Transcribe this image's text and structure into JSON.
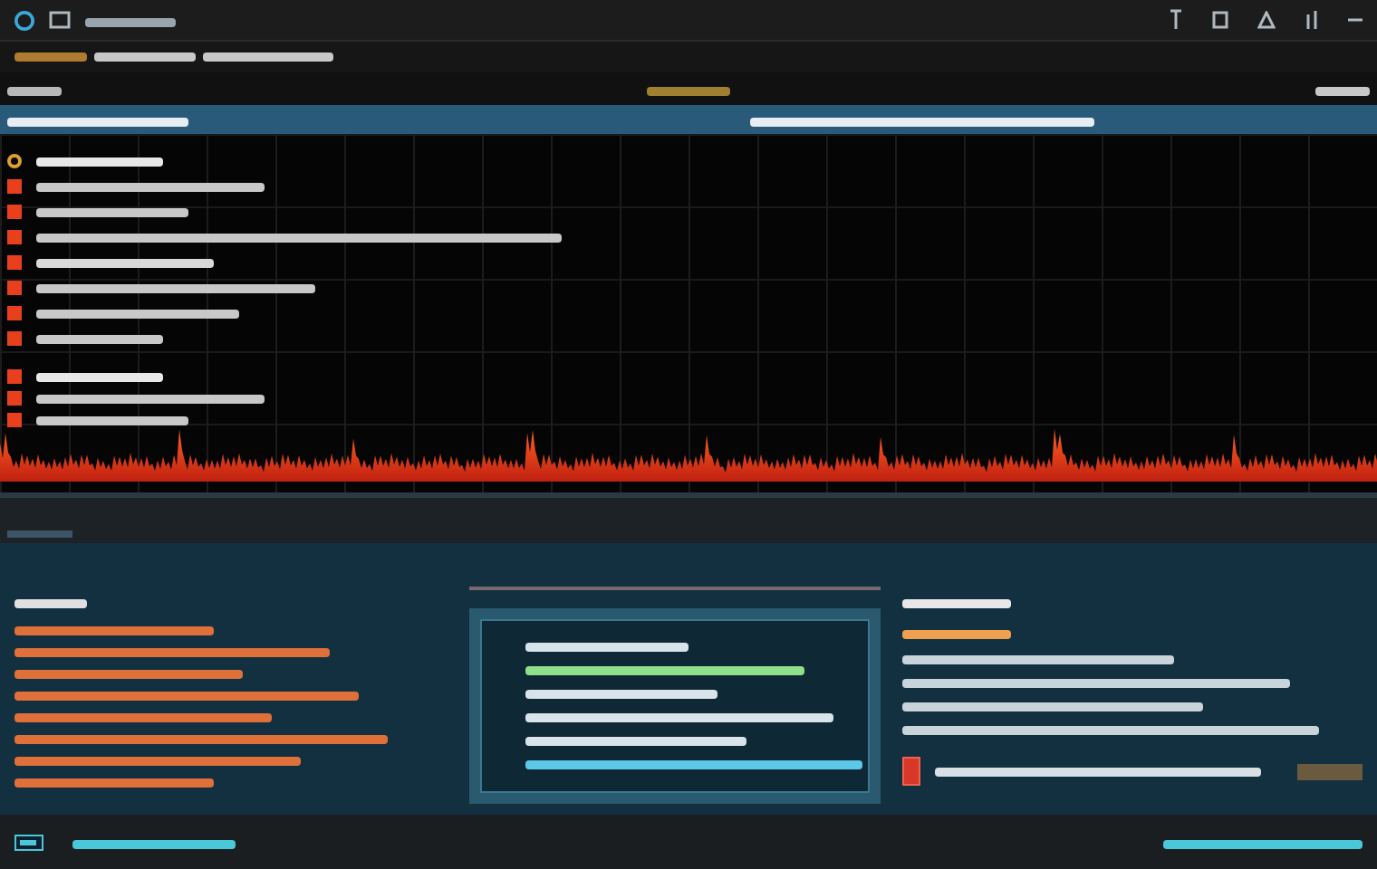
{
  "title_bar": {
    "scribbles": [
      {
        "color": "#9aa4ac"
      }
    ]
  },
  "toolbar": {
    "scribbles": [
      {
        "color": "#b07a30"
      },
      {
        "color": "#c8c8c8"
      },
      {
        "color": "#c8c8c8"
      }
    ]
  },
  "panel_header": {
    "left": [
      {
        "color": "#b8b8b8"
      }
    ],
    "center": [
      {
        "color": "#a08030"
      }
    ],
    "right": [
      {
        "color": "#c8c8c8"
      }
    ]
  },
  "blue_header": {
    "left": [
      {
        "color": "#e6eef4"
      }
    ],
    "center": [
      {
        "color": "#e6eef4"
      }
    ]
  },
  "log": {
    "blocks": [
      {
        "lines": [
          {
            "color": "#e8e8e8"
          },
          {
            "color": "#c8c8c8"
          },
          {
            "color": "#c8c8c8"
          },
          {
            "color": "#c8c8c8"
          },
          {
            "color": "#d8d8d8"
          },
          {
            "color": "#c8c8c8"
          },
          {
            "color": "#c8c8c8"
          },
          {
            "color": "#c8c8c8"
          }
        ]
      },
      {
        "lines": [
          {
            "color": "#e8e8e8"
          },
          {
            "color": "#c8c8c8"
          },
          {
            "color": "#c8c8c8"
          }
        ]
      }
    ]
  },
  "left_panel": {
    "heading": [
      {
        "color": "#e0e0e0"
      }
    ],
    "lines": [
      {
        "color": "#e0703a"
      },
      {
        "color": "#e0703a"
      },
      {
        "color": "#e0703a"
      },
      {
        "color": "#e0703a"
      },
      {
        "color": "#e0703a"
      },
      {
        "color": "#e0703a"
      },
      {
        "color": "#e0703a"
      },
      {
        "color": "#e0703a"
      }
    ]
  },
  "dialog": {
    "lines": [
      {
        "color": "#d8e4ea"
      },
      {
        "color": "#8ee08a"
      },
      {
        "color": "#d8e4ea"
      },
      {
        "color": "#d8e4ea"
      },
      {
        "color": "#d8e4ea"
      },
      {
        "color": "#5cc8e8"
      }
    ]
  },
  "right_panel": {
    "heading": [
      {
        "color": "#e8e8e8"
      }
    ],
    "subheading": [
      {
        "color": "#f0a050"
      }
    ],
    "lines": [
      {
        "color": "#c8d4da"
      },
      {
        "color": "#c8d4da"
      },
      {
        "color": "#c8d4da"
      },
      {
        "color": "#c8d4da"
      }
    ],
    "alert": [
      {
        "color": "#d8e0e4"
      }
    ]
  },
  "status_bar": {
    "left": [
      {
        "color": "#4ac8d8"
      }
    ],
    "right": [
      {
        "color": "#4ac8d8"
      }
    ]
  }
}
